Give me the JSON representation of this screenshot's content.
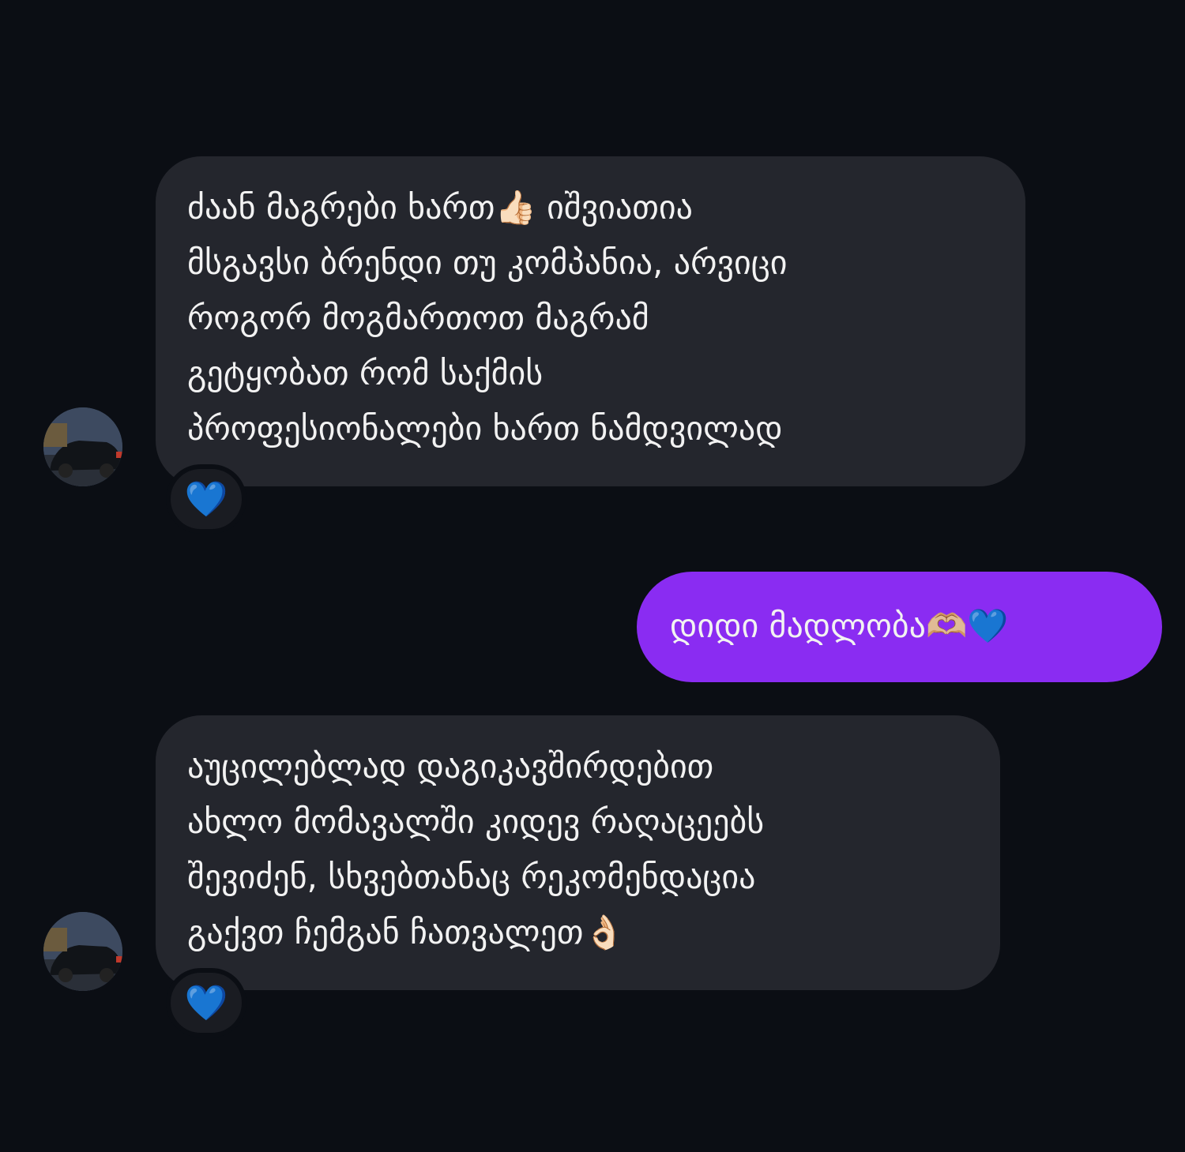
{
  "conversation": {
    "messages": [
      {
        "direction": "incoming",
        "lines": [
          "ძაან მაგრები ხართ👍🏻 იშვიათია",
          "მსგავსი ბრენდი თუ კომპანია, არვიცი",
          "როგორ მოგმართოთ მაგრამ",
          "გეტყობათ რომ საქმის",
          "პროფესიონალები ხართ ნამდვილად"
        ],
        "reaction": "💙"
      },
      {
        "direction": "outgoing",
        "text": "დიდი მადლობა🫶🏼💙"
      },
      {
        "direction": "incoming",
        "lines": [
          "აუცილებლად დაგიკავშირდებით",
          "ახლო მომავალში კიდევ რაღაცეებს",
          "შევიძენ, სხვებთანაც რეკომენდაცია",
          "გაქვთ ჩემგან ჩათვალეთ👌🏻"
        ],
        "reaction": "💙"
      }
    ]
  },
  "colors": {
    "background": "#0b0e14",
    "incoming_bubble": "#24262d",
    "outgoing_bubble": "#8a2cf2",
    "reaction_heart": "#1e8cff"
  }
}
